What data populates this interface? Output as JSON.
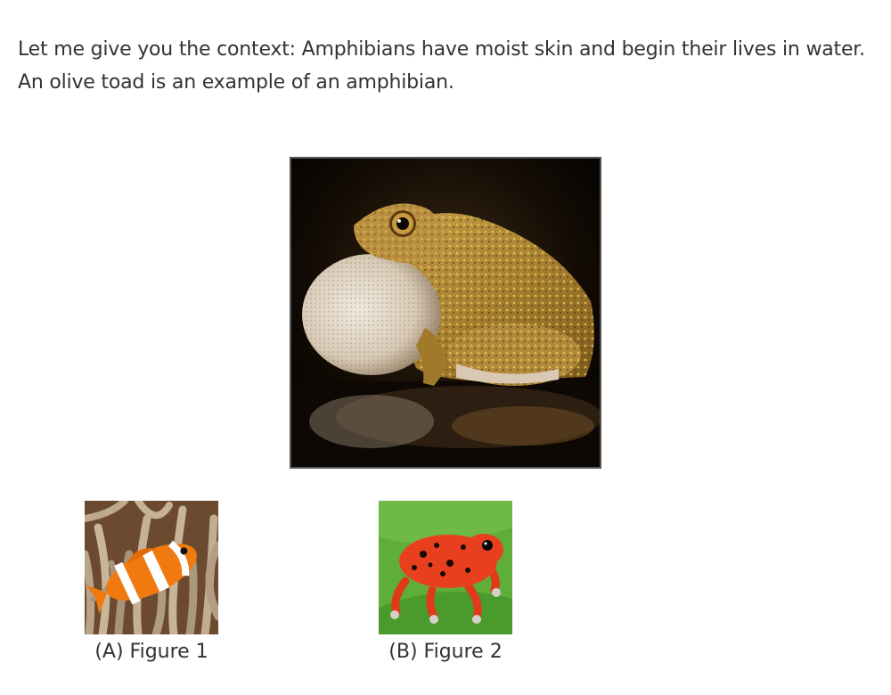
{
  "question": {
    "context_text": "Let me give you the context: Amphibians have moist skin and begin their lives in water. An olive toad is an example of an amphibian."
  },
  "main_image": {
    "icon": "olive-toad-photo"
  },
  "choices": [
    {
      "caption": "(A) Figure 1",
      "icon": "clownfish-photo"
    },
    {
      "caption": "(B) Figure 2",
      "icon": "red-poison-frog-photo"
    }
  ]
}
